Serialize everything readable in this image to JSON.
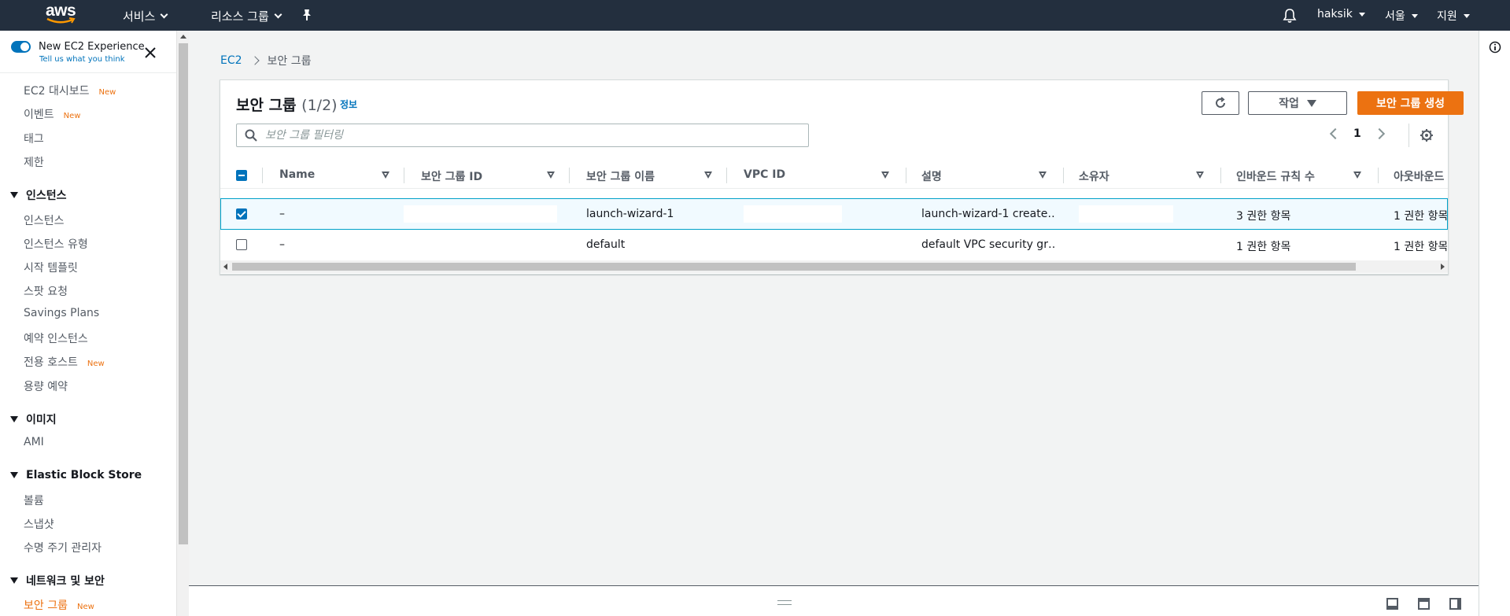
{
  "topnav": {
    "logo_text": "aws",
    "services": "서비스",
    "resource_groups": "리소스 그룹",
    "user": "haksik",
    "region": "서울",
    "support": "지원"
  },
  "sidebar": {
    "experience_title": "New EC2 Experience",
    "experience_sub": "Tell us what you think",
    "new_badge": "New",
    "items": {
      "dashboard": "EC2 대시보드",
      "events": "이벤트",
      "tags": "태그",
      "limits": "제한",
      "instances_section": "인스턴스",
      "instances": "인스턴스",
      "instance_types": "인스턴스 유형",
      "launch_templates": "시작 템플릿",
      "spot_requests": "스팟 요청",
      "savings_plans": "Savings Plans",
      "reserved_instances": "예약 인스턴스",
      "dedicated_hosts": "전용 호스트",
      "capacity_reservations": "용량 예약",
      "images_section": "이미지",
      "ami": "AMI",
      "ebs_section": "Elastic Block Store",
      "volumes": "볼륨",
      "snapshots": "스냅샷",
      "lifecycle_manager": "수명 주기 관리자",
      "network_section": "네트워크 및 보안",
      "security_groups": "보안 그룹"
    }
  },
  "breadcrumb": {
    "root": "EC2",
    "current": "보안 그룹"
  },
  "panel": {
    "title": "보안 그룹",
    "count": "(1/2)",
    "info": "정보",
    "action_label": "작업",
    "create_label": "보안 그룹 생성",
    "filter_placeholder": "보안 그룹 필터링",
    "page": "1"
  },
  "table": {
    "columns": [
      "Name",
      "보안 그룹 ID",
      "보안 그룹 이름",
      "VPC ID",
      "설명",
      "소유자",
      "인바운드 규칙 수",
      "아웃바운드"
    ],
    "rows": [
      {
        "name": "–",
        "group_name": "launch-wizard-1",
        "description": "launch-wizard-1 create…",
        "inbound": "3 권한 항목",
        "outbound": "1 권한 항목",
        "selected": true
      },
      {
        "name": "–",
        "group_name": "default",
        "description": "default VPC security gr…",
        "inbound": "1 권한 항목",
        "outbound": "1 권한 항목",
        "selected": false
      }
    ]
  },
  "colors": {
    "nav_bg": "#232f3e",
    "accent": "#ec7211",
    "link": "#0073bb",
    "selected_row": "#f1faff"
  }
}
